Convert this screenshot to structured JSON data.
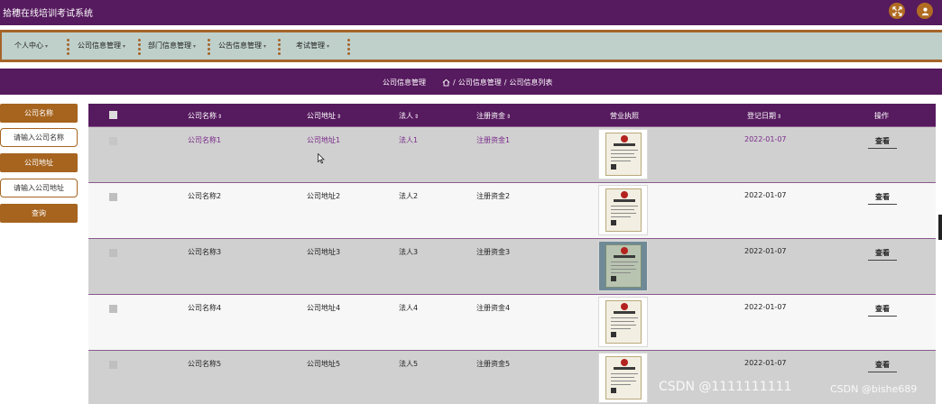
{
  "app": {
    "title": "拾穗在线培训考试系统"
  },
  "header_icons": [
    "fullscreen-icon",
    "user-avatar-icon"
  ],
  "nav": {
    "items": [
      {
        "label": "个人中心"
      },
      {
        "label": "公司信息管理"
      },
      {
        "label": "部门信息管理"
      },
      {
        "label": "公告信息管理"
      },
      {
        "label": "考试管理"
      }
    ]
  },
  "breadcrumb": {
    "title": "公司信息管理",
    "sep1": "/",
    "level1": "公司信息管理",
    "sep2": "/",
    "level2": "公司信息列表"
  },
  "search": {
    "name_label": "公司名称",
    "name_placeholder": "请输入公司名称",
    "address_label": "公司地址",
    "address_placeholder": "请输入公司地址",
    "query_button": "查询"
  },
  "table": {
    "columns": [
      "公司名称",
      "公司地址",
      "法人",
      "注册资金",
      "营业执照",
      "登记日期",
      "操作"
    ],
    "rows": [
      {
        "name": "公司名称1",
        "address": "公司地址1",
        "legal": "法人1",
        "capital": "注册资金1",
        "date": "2022-01-07",
        "action": "查看"
      },
      {
        "name": "公司名称2",
        "address": "公司地址2",
        "legal": "法人2",
        "capital": "注册资金2",
        "date": "2022-01-07",
        "action": "查看"
      },
      {
        "name": "公司名称3",
        "address": "公司地址3",
        "legal": "法人3",
        "capital": "注册资金3",
        "date": "2022-01-07",
        "action": "查看"
      },
      {
        "name": "公司名称4",
        "address": "公司地址4",
        "legal": "法人4",
        "capital": "注册资金4",
        "date": "2022-01-07",
        "action": "查看"
      },
      {
        "name": "公司名称5",
        "address": "公司地址5",
        "legal": "法人5",
        "capital": "注册资金5",
        "date": "2022-01-07",
        "action": "查看"
      }
    ]
  },
  "watermarks": {
    "center": "CSDN @1111111111",
    "right": "CSDN @bishe689"
  },
  "colors": {
    "primary": "#561a5e",
    "accent": "#a6641f",
    "nav_bg": "#bfd0cb"
  }
}
